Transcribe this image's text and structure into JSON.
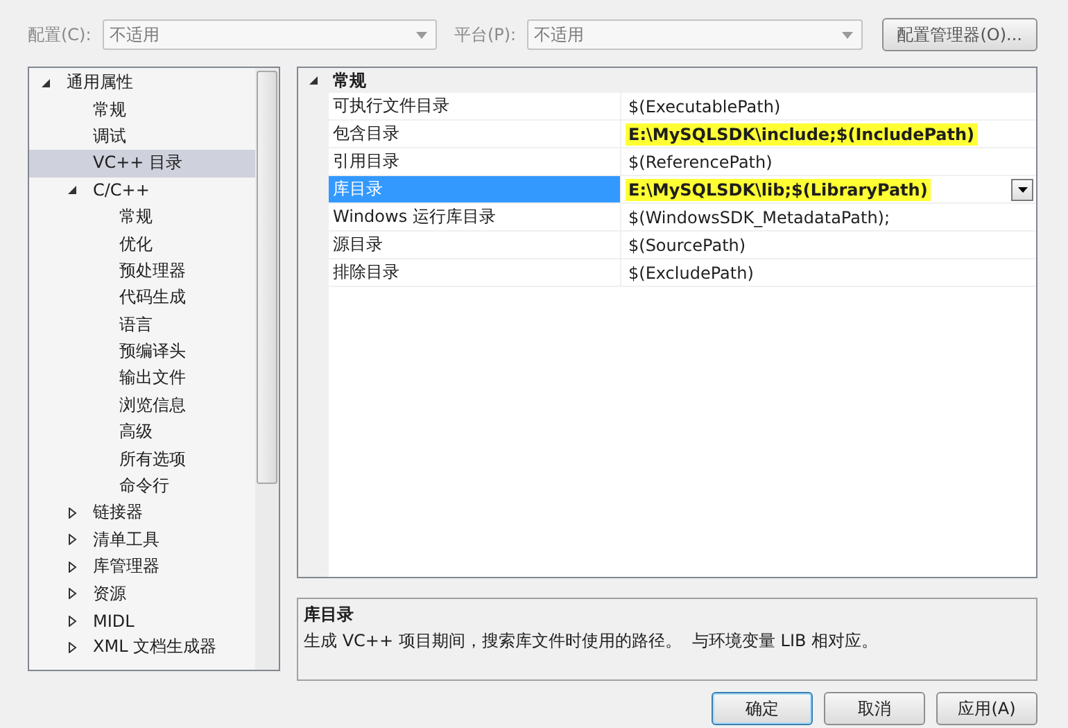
{
  "toolbar": {
    "config_label": "配置(C):",
    "config_value": "不适用",
    "platform_label": "平台(P):",
    "platform_value": "不适用",
    "manager_button": "配置管理器(O)..."
  },
  "tree": [
    {
      "label": "通用属性",
      "expanded": true,
      "selected": false,
      "children": [
        {
          "label": "常规",
          "selected": false
        },
        {
          "label": "调试",
          "selected": false
        },
        {
          "label": "VC++ 目录",
          "selected": true
        },
        {
          "label": "C/C++",
          "expanded": true,
          "selected": false,
          "children": [
            {
              "label": "常规",
              "selected": false
            },
            {
              "label": "优化",
              "selected": false
            },
            {
              "label": "预处理器",
              "selected": false
            },
            {
              "label": "代码生成",
              "selected": false
            },
            {
              "label": "语言",
              "selected": false
            },
            {
              "label": "预编译头",
              "selected": false
            },
            {
              "label": "输出文件",
              "selected": false
            },
            {
              "label": "浏览信息",
              "selected": false
            },
            {
              "label": "高级",
              "selected": false
            },
            {
              "label": "所有选项",
              "selected": false
            },
            {
              "label": "命令行",
              "selected": false
            }
          ]
        },
        {
          "label": "链接器",
          "expanded": false,
          "selected": false
        },
        {
          "label": "清单工具",
          "expanded": false,
          "selected": false
        },
        {
          "label": "库管理器",
          "expanded": false,
          "selected": false
        },
        {
          "label": "资源",
          "expanded": false,
          "selected": false
        },
        {
          "label": "MIDL",
          "expanded": false,
          "selected": false
        },
        {
          "label": "XML 文档生成器",
          "expanded": false,
          "selected": false
        }
      ]
    }
  ],
  "grid": {
    "category": "常规",
    "expanded": true,
    "rows": [
      {
        "name": "可执行文件目录",
        "value": "$(ExecutablePath)",
        "selected": false,
        "bold": false,
        "highlighted": false
      },
      {
        "name": "包含目录",
        "value": "E:\\MySQLSDK\\include;$(IncludePath)",
        "selected": false,
        "bold": true,
        "highlighted": true
      },
      {
        "name": "引用目录",
        "value": "$(ReferencePath)",
        "selected": false,
        "bold": false,
        "highlighted": false
      },
      {
        "name": "库目录",
        "value": "E:\\MySQLSDK\\lib;$(LibraryPath)",
        "selected": true,
        "bold": true,
        "highlighted": true
      },
      {
        "name": "Windows 运行库目录",
        "value": "$(WindowsSDK_MetadataPath);",
        "selected": false,
        "bold": false,
        "highlighted": false
      },
      {
        "name": "源目录",
        "value": "$(SourcePath)",
        "selected": false,
        "bold": false,
        "highlighted": false
      },
      {
        "name": "排除目录",
        "value": "$(ExcludePath)",
        "selected": false,
        "bold": false,
        "highlighted": false
      }
    ]
  },
  "description": {
    "title": "库目录",
    "text": "生成 VC++ 项目期间，搜索库文件时使用的路径。  与环境变量 LIB 相对应。"
  },
  "buttons": [
    {
      "label": "确定",
      "default": true
    },
    {
      "label": "取消",
      "default": false
    },
    {
      "label": "应用(A)",
      "default": false
    }
  ]
}
